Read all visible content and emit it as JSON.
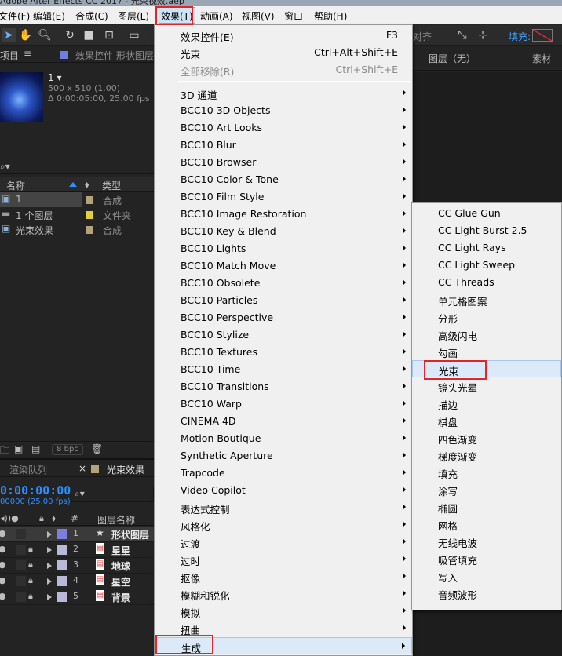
{
  "window": {
    "title": "Adobe After Effects CC 2017 - 光束视效.aep"
  },
  "menubar": [
    {
      "label": "文件(F)",
      "active": false
    },
    {
      "label": "编辑(E)",
      "active": false
    },
    {
      "label": "合成(C)",
      "active": false
    },
    {
      "label": "图层(L)",
      "active": false
    },
    {
      "label": "效果(T)",
      "active": true
    },
    {
      "label": "动画(A)",
      "active": false
    },
    {
      "label": "视图(V)",
      "active": false
    },
    {
      "label": "窗口",
      "active": false
    },
    {
      "label": "帮助(H)",
      "active": false
    }
  ],
  "toolbar": {
    "align_text": "对齐",
    "fill_label": "填充:"
  },
  "project_panel": {
    "tab_project": "项目",
    "tab_effect_controls": "效果控件 形状图层",
    "item_name": "1 ▾",
    "item_info_size": "500 x 510 (1.00)",
    "item_info_duration": "Δ 0:00:05:00, 25.00 fps",
    "search_icon": "⌕▾",
    "columns": {
      "name": "名称",
      "type": "类型"
    },
    "rows": [
      {
        "name": "1",
        "type": "合成",
        "icon": "comp-icon",
        "swatch": "#b4a27a",
        "selected": true
      },
      {
        "name": "1 个图层",
        "type": "文件夹",
        "icon": "folder-icon",
        "swatch": "#e0d040",
        "selected": false
      },
      {
        "name": "光束效果",
        "type": "合成",
        "icon": "comp-icon",
        "swatch": "#b4a27a",
        "selected": false
      }
    ],
    "bpc": "8 bpc"
  },
  "timeline_panel": {
    "tab_render": "渲染队列",
    "tab_comp": "光束效果",
    "timecode": "0:00:00:00",
    "fps_line": "00000 (25.00 fps)",
    "search_icon": "⌕▾",
    "col_num": "#",
    "col_layer_name": "图层名称",
    "layers": [
      {
        "num": "1",
        "name": "形状图层",
        "icon": "star-icon",
        "color": "#7d7ee0",
        "locked": false,
        "selected": true
      },
      {
        "num": "2",
        "name": "星星",
        "icon": "image-icon",
        "color": "#b8b8d8",
        "locked": true,
        "selected": false
      },
      {
        "num": "3",
        "name": "地球",
        "icon": "image-icon",
        "color": "#b8b8d8",
        "locked": true,
        "selected": false
      },
      {
        "num": "4",
        "name": "星空",
        "icon": "image-icon",
        "color": "#b8b8d8",
        "locked": true,
        "selected": false
      },
      {
        "num": "5",
        "name": "背景",
        "icon": "image-icon",
        "color": "#b8b8d8",
        "locked": true,
        "selected": false
      }
    ]
  },
  "comp_panel": {
    "layer_label": "图层（无）",
    "footage_label": "素材"
  },
  "effects_menu": {
    "top_items": [
      {
        "label": "效果控件(E)",
        "shortcut": "F3",
        "disabled": false
      },
      {
        "label": "光束",
        "shortcut": "Ctrl+Alt+Shift+E",
        "disabled": false
      },
      {
        "label": "全部移除(R)",
        "shortcut": "Ctrl+Shift+E",
        "disabled": true
      }
    ],
    "categories": [
      "3D 通道",
      "BCC10 3D Objects",
      "BCC10 Art Looks",
      "BCC10 Blur",
      "BCC10 Browser",
      "BCC10 Color & Tone",
      "BCC10 Film Style",
      "BCC10 Image Restoration",
      "BCC10 Key & Blend",
      "BCC10 Lights",
      "BCC10 Match Move",
      "BCC10 Obsolete",
      "BCC10 Particles",
      "BCC10 Perspective",
      "BCC10 Stylize",
      "BCC10 Textures",
      "BCC10 Time",
      "BCC10 Transitions",
      "BCC10 Warp",
      "CINEMA 4D",
      "Motion Boutique",
      "Synthetic Aperture",
      "Trapcode",
      "Video Copilot",
      "表达式控制",
      "风格化",
      "过渡",
      "过时",
      "抠像",
      "模糊和锐化",
      "模拟",
      "扭曲",
      "生成"
    ],
    "highlighted_category": "生成"
  },
  "generate_submenu": {
    "items": [
      "CC Glue Gun",
      "CC Light Burst 2.5",
      "CC Light Rays",
      "CC Light Sweep",
      "CC Threads",
      "单元格图案",
      "分形",
      "高级闪电",
      "勾画",
      "光束",
      "镜头光晕",
      "描边",
      "棋盘",
      "四色渐变",
      "梯度渐变",
      "填充",
      "涂写",
      "椭圆",
      "网格",
      "无线电波",
      "吸管填充",
      "写入",
      "音频波形"
    ],
    "highlighted_item": "光束"
  },
  "colors": {
    "accent": "#2c8fff",
    "highlight_border": "#e0262b",
    "menu_bg": "#f0f0f0",
    "panel_bg": "#232323"
  }
}
